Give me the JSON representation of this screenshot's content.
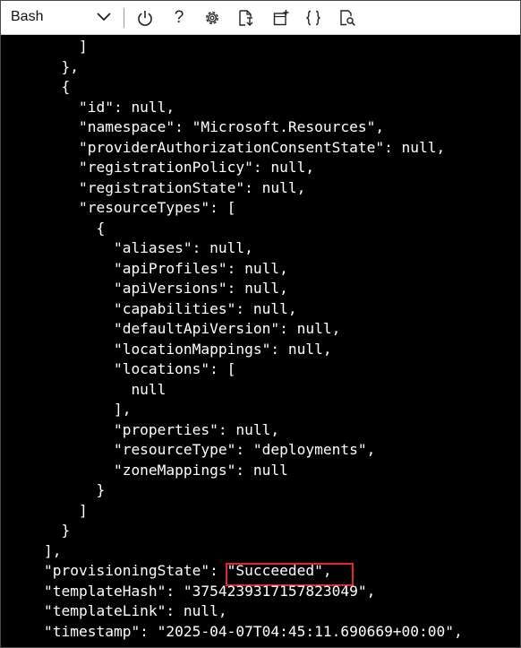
{
  "toolbar": {
    "shell_label": "Bash",
    "icons": [
      "chevron-down-icon",
      "power-icon",
      "help-icon",
      "gear-icon",
      "upload-download-icon",
      "new-session-icon",
      "editor-braces-icon",
      "web-preview-icon"
    ],
    "help_glyph": "?"
  },
  "terminal": {
    "lines": [
      "        ]",
      "      },",
      "      {",
      "        \"id\": null,",
      "        \"namespace\": \"Microsoft.Resources\",",
      "        \"providerAuthorizationConsentState\": null,",
      "        \"registrationPolicy\": null,",
      "        \"registrationState\": null,",
      "        \"resourceTypes\": [",
      "          {",
      "            \"aliases\": null,",
      "            \"apiProfiles\": null,",
      "            \"apiVersions\": null,",
      "            \"capabilities\": null,",
      "            \"defaultApiVersion\": null,",
      "            \"locationMappings\": null,",
      "            \"locations\": [",
      "              null",
      "            ],",
      "            \"properties\": null,",
      "            \"resourceType\": \"deployments\",",
      "            \"zoneMappings\": null",
      "          }",
      "        ]",
      "      }",
      "    ],",
      "    \"provisioningState\": \"Succeeded\",",
      "    \"templateHash\": \"3754239317157823049\",",
      "    \"templateLink\": null,",
      "    \"timestamp\": \"2025-04-07T04:45:11.690669+00:00\","
    ],
    "text_color": "#ffffff",
    "background": "#000000",
    "highlight_color": "#e2272c"
  }
}
